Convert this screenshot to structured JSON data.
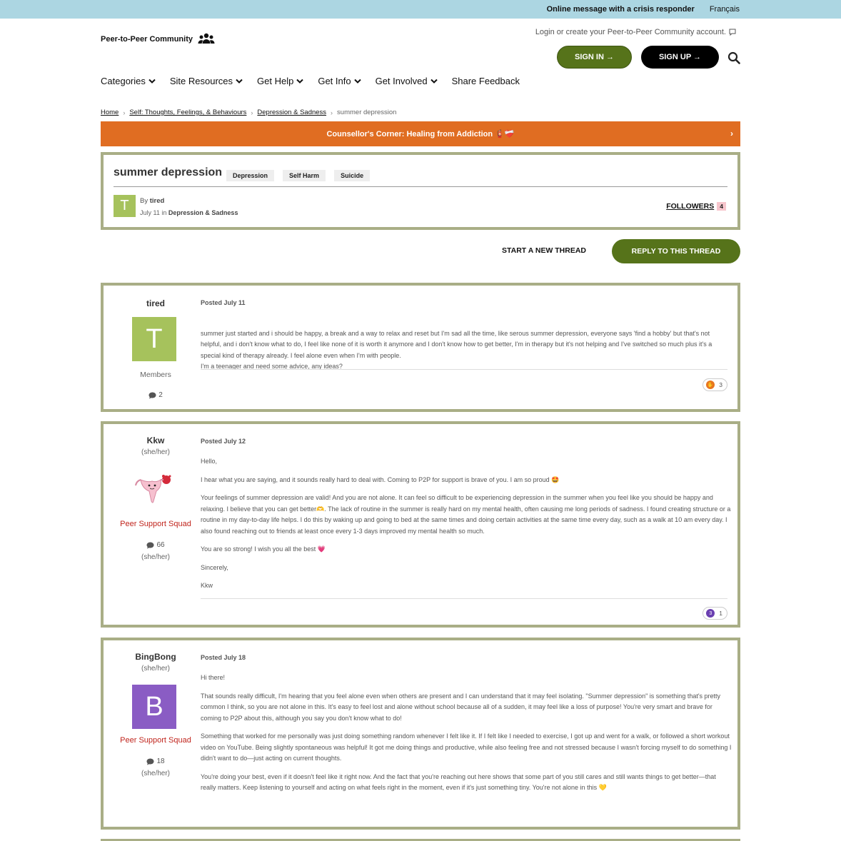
{
  "topbar": {
    "crisis_link": "Online message with a crisis responder",
    "language_link": "Français"
  },
  "header": {
    "brand": "Peer-to-Peer Community",
    "account_prompt": "Login or create your Peer-to-Peer Community account.",
    "sign_in": "SIGN IN →",
    "sign_up": "SIGN UP →"
  },
  "nav": {
    "items": [
      {
        "label": "Categories"
      },
      {
        "label": "Site Resources"
      },
      {
        "label": "Get Help"
      },
      {
        "label": "Get Info"
      },
      {
        "label": "Get Involved"
      },
      {
        "label": "Share Feedback"
      }
    ]
  },
  "breadcrumb": {
    "items": [
      "Home",
      "Self: Thoughts, Feelings, & Behaviours",
      "Depression & Sadness"
    ],
    "current": "summer depression"
  },
  "banner": {
    "text": "Counsellor's Corner: Healing from Addiction 🧯❤️‍🩹",
    "chevron": "›"
  },
  "thread": {
    "title": "summer depression",
    "tags": [
      "Depression",
      "Self Harm",
      "Suicide"
    ],
    "avatar_letter": "T",
    "by_prefix": "By",
    "author": "tired",
    "date": "July 11",
    "in_word": "in",
    "category": "Depression & Sadness",
    "followers_label": "FOLLOWERS",
    "followers_count": "4"
  },
  "actions": {
    "start_thread": "START A NEW THREAD",
    "reply": "REPLY TO THIS THREAD"
  },
  "colors": {
    "accent_green": "#56731a",
    "banner_orange": "#e06d22",
    "border_olive": "#a9ae86",
    "squad_red": "#c0241c",
    "topbar_blue": "#acd6e2"
  },
  "posts": [
    {
      "username": "tired",
      "avatar_letter": "T",
      "avatar_color": "#a6c25c",
      "role": "Members",
      "post_count": "2",
      "posted": "Posted July 11",
      "paragraphs": [
        "summer just started and i should be happy, a break and a way to relax and reset but I'm sad all the time, like serous summer depression, everyone says 'find a hobby' but that's not helpful, and i don't know what to do, I feel like none of it is worth it anymore and I don't know how to get better, I'm in therapy but it's not helping and I've switched so much plus it's a special kind of therapy already. I feel alone even when I'm with people.\nI'm a teenager and need some advice, any ideas?"
      ],
      "reaction_count": "3",
      "reaction_icon": "✋"
    },
    {
      "username": "Kkw",
      "pronouns": "(she/her)",
      "role": "Peer Support Squad",
      "post_count": "66",
      "pronouns_bottom": "(she/her)",
      "posted": "Posted July 12",
      "paragraphs": [
        "Hello,",
        "I hear what you are saying, and it sounds really hard to deal with. Coming to P2P for support is brave of you. I am so proud 🤩",
        "Your feelings of summer depression are valid! And you are not alone. It can feel so difficult to be experiencing depression in the summer when you feel like you should be happy and relaxing. I believe that you can get better🫶. The lack of routine in the summer is really hard on my mental health, often causing me long periods of sadness.  I found creating structure or a routine in my day-to-day life helps. I do this by waking up and going to bed at the same times and doing certain activities at the same time every day, such as a walk at 10 am every day. I also found reaching out to friends at least once every 1-3 days improved my mental health so much.",
        "You are so strong! I wish you all the best 💗",
        "Sincerely,",
        "Kkw"
      ],
      "reaction_count": "1",
      "reaction_icon": "3"
    },
    {
      "username": "BingBong",
      "pronouns": "(she/her)",
      "avatar_letter": "B",
      "avatar_color": "#8a5cc4",
      "role": "Peer Support Squad",
      "post_count": "18",
      "pronouns_bottom": "(she/her)",
      "posted": "Posted July 18",
      "paragraphs": [
        "Hi there!",
        "That sounds really difficult, I'm hearing that you feel alone even when others are present and I can understand that it may feel isolating. \"Summer depression\" is something that's pretty common I think, so you are not alone in this. It's easy to feel lost and alone without school because all of a sudden, it may feel like a loss of purpose! You're very smart and brave for coming to P2P about this, although you say you don't know what to do!",
        "Something that worked for me personally was just doing something random whenever I felt like it. If I felt like I needed to exercise, I got up and went for a walk, or followed a short workout video on YouTube. Being slightly spontaneous was helpful! It got me doing things and productive, while also feeling free and not stressed because I wasn't forcing myself to do something I didn't want to do—just acting on current thoughts.",
        "You're doing your best, even if it doesn't feel like it right now. And the fact that you're reaching out here shows that some part of you still cares and still wants things to get better—that really matters. Keep listening to yourself and acting on what feels right in the moment, even if it's just something tiny. You're not alone in this 💛"
      ]
    }
  ]
}
